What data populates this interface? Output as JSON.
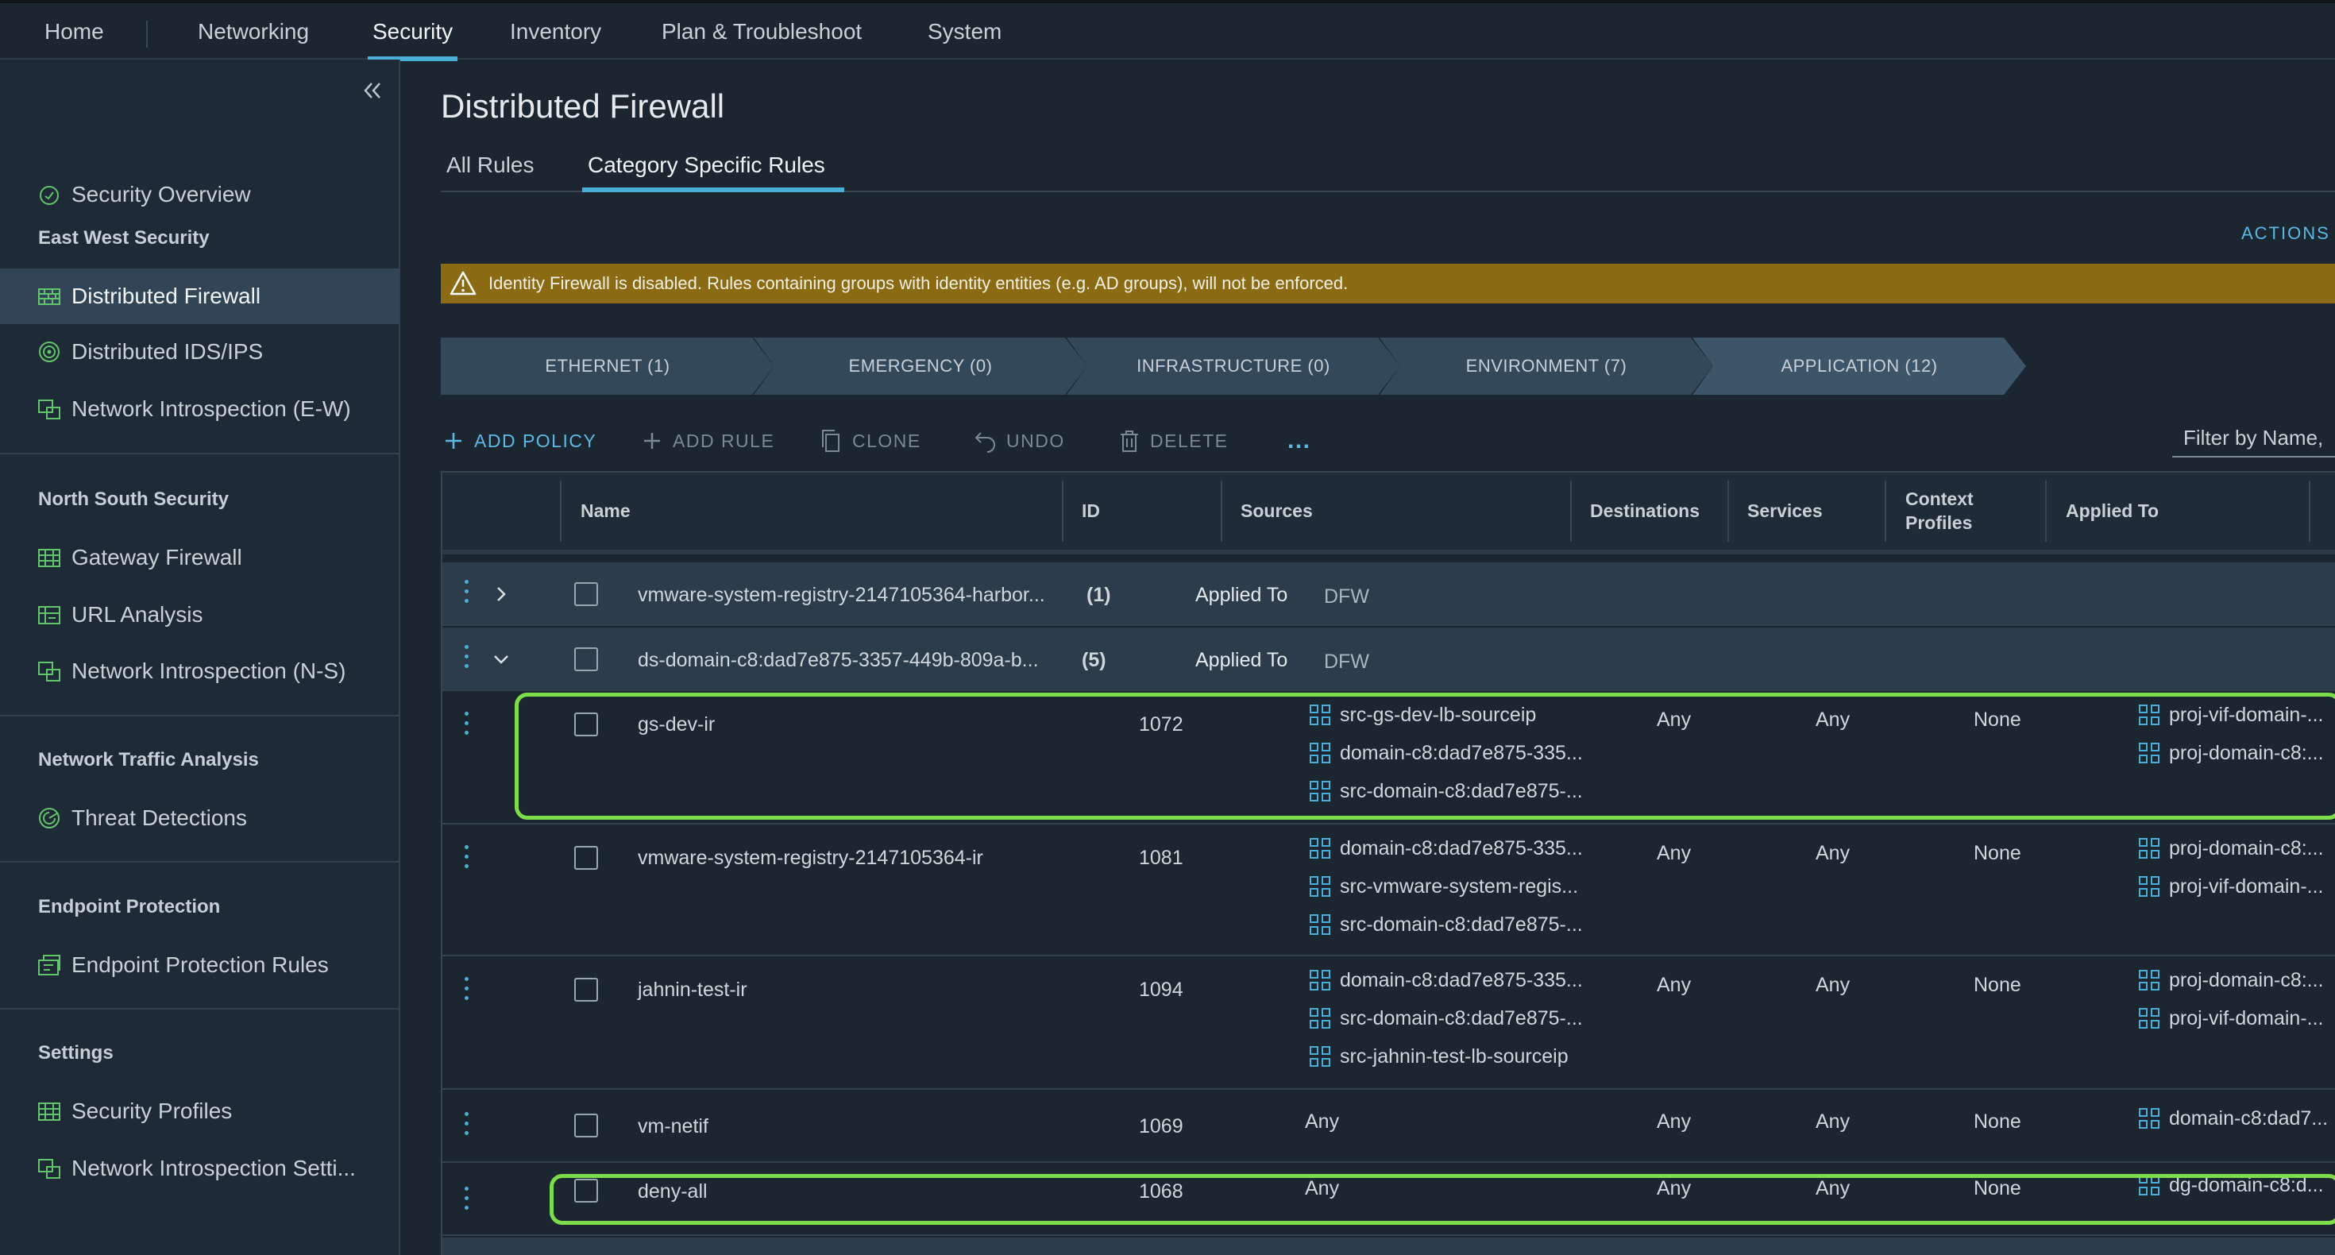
{
  "topnav": {
    "tabs": [
      "Home",
      "Networking",
      "Security",
      "Inventory",
      "Plan & Troubleshoot",
      "System"
    ],
    "active": "Security"
  },
  "sidebar": {
    "overview": "Security Overview",
    "sections": [
      {
        "title": "East West Security",
        "items": [
          "Distributed Firewall",
          "Distributed IDS/IPS",
          "Network Introspection (E-W)"
        ]
      },
      {
        "title": "North South Security",
        "items": [
          "Gateway Firewall",
          "URL Analysis",
          "Network Introspection (N-S)"
        ]
      },
      {
        "title": "Network Traffic Analysis",
        "items": [
          "Threat Detections"
        ]
      },
      {
        "title": "Endpoint Protection",
        "items": [
          "Endpoint Protection Rules"
        ]
      },
      {
        "title": "Settings",
        "items": [
          "Security Profiles",
          "Network Introspection Setti..."
        ]
      }
    ],
    "active_item": "Distributed Firewall"
  },
  "page": {
    "title": "Distributed Firewall",
    "tabs": [
      "All Rules",
      "Category Specific Rules"
    ],
    "active_tab": "Category Specific Rules",
    "actions": "ACTIONS"
  },
  "banner": {
    "text": "Identity Firewall is disabled. Rules containing groups with identity entities (e.g. AD groups), will not be enforced.",
    "color": "#8b6a14"
  },
  "categories": [
    "ETHERNET (1)",
    "EMERGENCY (0)",
    "INFRASTRUCTURE (0)",
    "ENVIRONMENT (7)",
    "APPLICATION (12)"
  ],
  "toolbar": {
    "add_policy": "ADD POLICY",
    "add_rule": "ADD RULE",
    "clone": "CLONE",
    "undo": "UNDO",
    "delete": "DELETE",
    "more": "...",
    "filter_placeholder": "Filter by Name,"
  },
  "grid": {
    "columns": [
      "Name",
      "ID",
      "Sources",
      "Destinations",
      "Services",
      "Context\nProfiles",
      "Applied To"
    ],
    "policies": [
      {
        "name": "vmware-system-registry-2147105364-harbor...",
        "count": "(1)",
        "applied_label": "Applied To",
        "applied": "DFW",
        "expanded": false
      },
      {
        "name": "ds-domain-c8:dad7e875-3357-449b-809a-b...",
        "count": "(5)",
        "applied_label": "Applied To",
        "applied": "DFW",
        "expanded": true
      }
    ],
    "rules": [
      {
        "name": "gs-dev-ir",
        "id": "1072",
        "sources": [
          "src-gs-dev-lb-sourceip",
          "domain-c8:dad7e875-335...",
          "src-domain-c8:dad7e875-..."
        ],
        "destinations": "Any",
        "services": "Any",
        "profiles": "None",
        "applied_to": [
          "proj-vif-domain-...",
          "proj-domain-c8:..."
        ],
        "highlighted": true
      },
      {
        "name": "vmware-system-registry-2147105364-ir",
        "id": "1081",
        "sources": [
          "domain-c8:dad7e875-335...",
          "src-vmware-system-regis...",
          "src-domain-c8:dad7e875-..."
        ],
        "destinations": "Any",
        "services": "Any",
        "profiles": "None",
        "applied_to": [
          "proj-domain-c8:...",
          "proj-vif-domain-..."
        ],
        "highlighted": false
      },
      {
        "name": "jahnin-test-ir",
        "id": "1094",
        "sources": [
          "domain-c8:dad7e875-335...",
          "src-domain-c8:dad7e875-...",
          "src-jahnin-test-lb-sourceip"
        ],
        "destinations": "Any",
        "services": "Any",
        "profiles": "None",
        "applied_to": [
          "proj-domain-c8:...",
          "proj-vif-domain-..."
        ],
        "highlighted": false
      },
      {
        "name": "vm-netif",
        "id": "1069",
        "sources_any": "Any",
        "destinations": "Any",
        "services": "Any",
        "profiles": "None",
        "applied_to": [
          "domain-c8:dad7..."
        ],
        "highlighted": false
      },
      {
        "name": "deny-all",
        "id": "1068",
        "sources_any": "Any",
        "destinations": "Any",
        "services": "Any",
        "profiles": "None",
        "applied_to": [
          "dg-domain-c8:d..."
        ],
        "highlighted": true
      }
    ]
  },
  "colors": {
    "accent": "#49afd9",
    "highlight": "#7ddc4a",
    "warning_bar": "#8b6a14"
  }
}
